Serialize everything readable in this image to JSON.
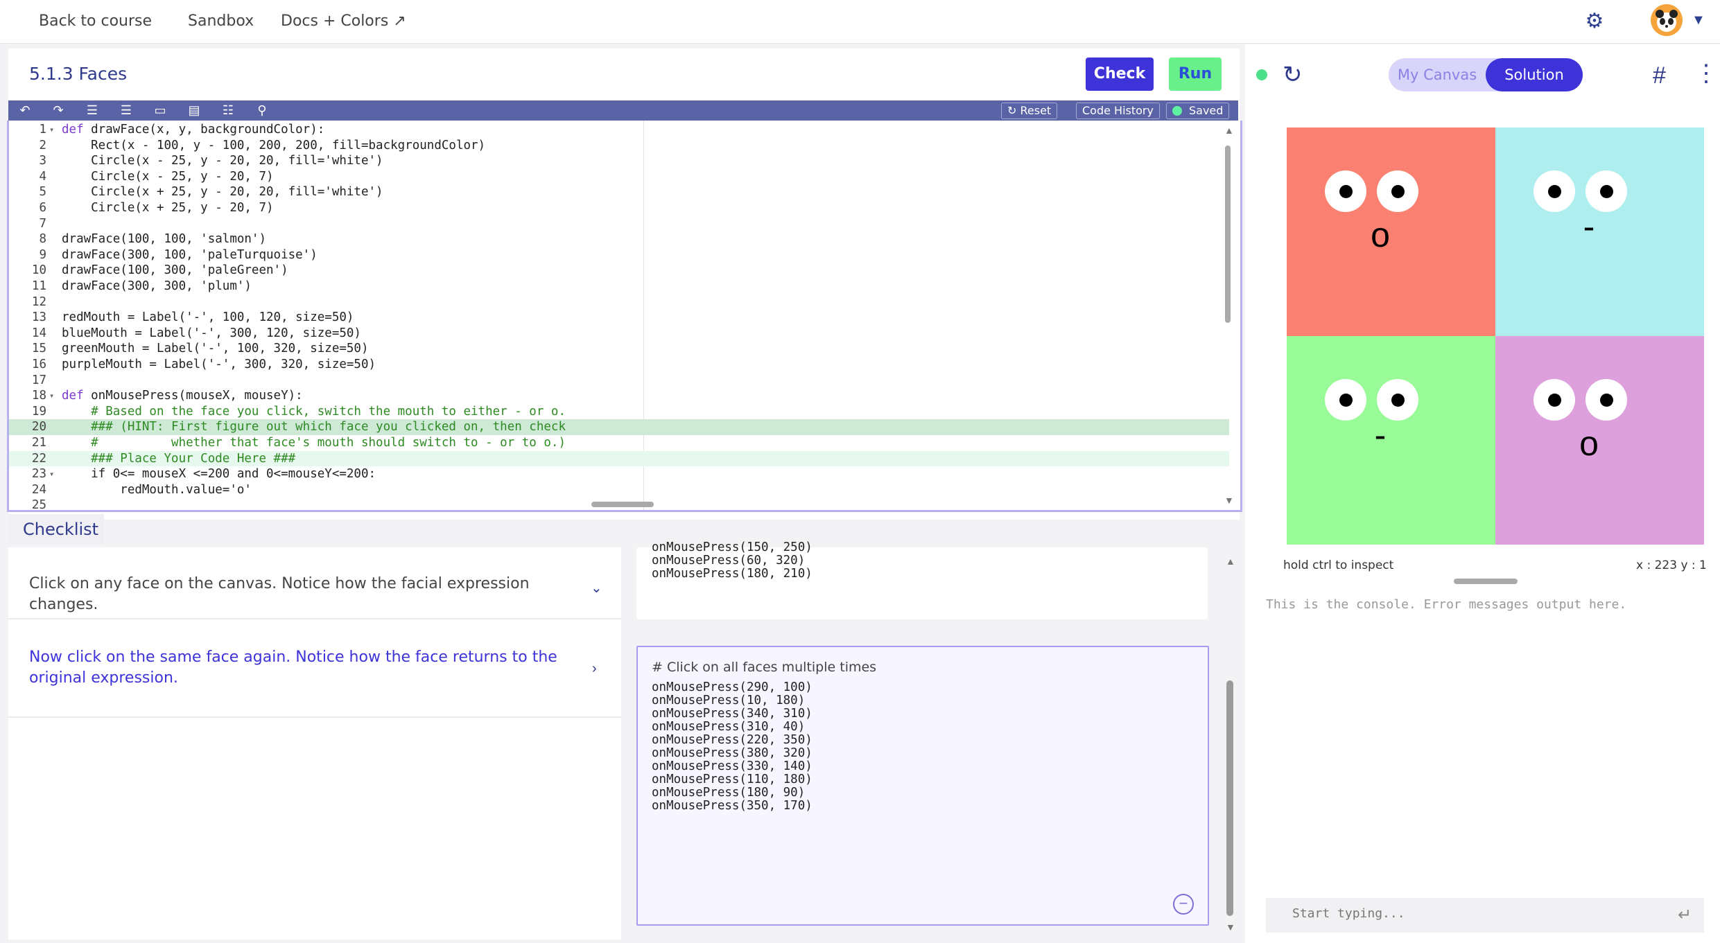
{
  "nav": {
    "back": "Back to course",
    "sandbox": "Sandbox",
    "docs": "Docs + Colors ↗"
  },
  "editor_header": {
    "title": "5.1.3 Faces",
    "check": "Check",
    "run": "Run"
  },
  "toolbar": {
    "reset": "↻ Reset",
    "history": "Code History",
    "saved": "Saved"
  },
  "code": [
    [
      "def",
      " drawFace(x, y, backgroundColor):"
    ],
    [
      "",
      "    Rect(x - 100, y - 100, 200, 200, fill=backgroundColor)"
    ],
    [
      "",
      "    Circle(x - 25, y - 20, 20, fill='white')"
    ],
    [
      "",
      "    Circle(x - 25, y - 20, 7)"
    ],
    [
      "",
      "    Circle(x + 25, y - 20, 20, fill='white')"
    ],
    [
      "",
      "    Circle(x + 25, y - 20, 7)"
    ],
    [
      "",
      ""
    ],
    [
      "",
      "drawFace(100, 100, 'salmon')"
    ],
    [
      "",
      "drawFace(300, 100, 'paleTurquoise')"
    ],
    [
      "",
      "drawFace(100, 300, 'paleGreen')"
    ],
    [
      "",
      "drawFace(300, 300, 'plum')"
    ],
    [
      "",
      ""
    ],
    [
      "",
      "redMouth = Label('-', 100, 120, size=50)"
    ],
    [
      "",
      "blueMouth = Label('-', 300, 120, size=50)"
    ],
    [
      "",
      "greenMouth = Label('-', 100, 320, size=50)"
    ],
    [
      "",
      "purpleMouth = Label('-', 300, 320, size=50)"
    ],
    [
      "",
      ""
    ],
    [
      "def",
      " onMousePress(mouseX, mouseY):"
    ],
    [
      "cm",
      "    # Based on the face you click, switch the mouth to either - or o."
    ],
    [
      "cm",
      "    ### (HINT: First figure out which face you clicked on, then check"
    ],
    [
      "cm",
      "    #          whether that face's mouth should switch to - or to o.)"
    ],
    [
      "cm",
      "    ### Place Your Code Here ###"
    ],
    [
      "if",
      "    if 0<= mouseX <=200 and 0<=mouseY<=200:"
    ],
    [
      "",
      "        redMouth.value='o'"
    ],
    [
      "",
      ""
    ]
  ],
  "checklist": {
    "tab": "Checklist",
    "items": [
      "Click on any face on the canvas. Notice how the facial expression changes.",
      "Now click on the same face again. Notice how the face returns to the original expression."
    ]
  },
  "tests": {
    "box1": [
      "onMousePress(150, 250)",
      "onMousePress(60, 320)",
      "onMousePress(180, 210)"
    ],
    "box2_comment": "# Click on all faces multiple times",
    "box2": [
      "onMousePress(290, 100)",
      "onMousePress(10, 180)",
      "onMousePress(340, 310)",
      "onMousePress(310, 40)",
      "onMousePress(220, 350)",
      "onMousePress(380, 320)",
      "onMousePress(330, 140)",
      "onMousePress(110, 180)",
      "onMousePress(180, 90)",
      "onMousePress(350, 170)"
    ]
  },
  "canvas_panel": {
    "my_canvas": "My Canvas",
    "solution": "Solution",
    "inspect_hint": "hold ctrl to inspect",
    "coords": "x : 223  y : 1",
    "console_msg": "This is the console. Error messages output here.",
    "console_placeholder": "Start typing..."
  },
  "faces": [
    {
      "color": "#fa8072",
      "mouth": "o"
    },
    {
      "color": "#afeeee",
      "mouth": "-"
    },
    {
      "color": "#98fb98",
      "mouth": "-"
    },
    {
      "color": "#dda0dd",
      "mouth": "o"
    }
  ],
  "colors": {
    "accent": "#3d33d9",
    "run": "#68f08a",
    "toolbar": "#5a63a6"
  }
}
